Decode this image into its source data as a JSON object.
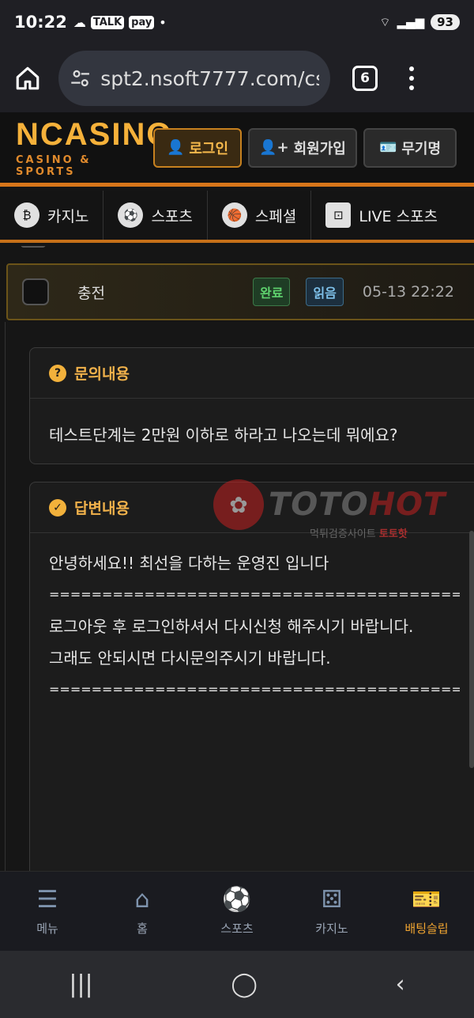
{
  "status": {
    "time": "10:22",
    "icons": [
      "cloud-icon",
      "talk-icon",
      "pay-icon"
    ],
    "talk": "TALK",
    "pay": "pay",
    "battery": "93"
  },
  "browser": {
    "url": "spt2.nsoft7777.com/cs",
    "tab_count": "6"
  },
  "header": {
    "logo_main": "NCASINO",
    "logo_sub": "CASINO & SPORTS",
    "login": "로그인",
    "signup": "회원가입",
    "anon": "무기명"
  },
  "nav": [
    {
      "label": "카지노",
      "icon": "casino-chip-icon"
    },
    {
      "label": "스포츠",
      "icon": "soccer-ball-icon"
    },
    {
      "label": "스페셜",
      "icon": "basketball-icon"
    },
    {
      "label": "LIVE 스포츠",
      "icon": "live-field-icon"
    }
  ],
  "notice": {
    "title": "충전",
    "status": "완료",
    "read": "읽음",
    "date": "05-13 22:22"
  },
  "inquiry": {
    "heading": "문의내용",
    "text": "테스트단계는 2만원 이하로 하라고 나오는데 뭐에요?"
  },
  "answer": {
    "heading": "답변내용",
    "lines": [
      "안녕하세요!! 최선을 다하는 운영진 입니다",
      "",
      "================================================",
      "",
      "로그아웃 후 로그인하셔서 다시신청 해주시기 바랍니다.",
      "그래도 안되시면 다시문의주시기 바랍니다.",
      "",
      "",
      "================================================"
    ]
  },
  "watermark": {
    "brand_a": "TOTO",
    "brand_b": "HOT",
    "sub_a": "먹튀검증사이트 ",
    "sub_b": "토토핫"
  },
  "bottom_nav": [
    {
      "label": "메뉴",
      "icon": "hamburger-icon"
    },
    {
      "label": "홈",
      "icon": "home-icon"
    },
    {
      "label": "스포츠",
      "icon": "soccer-ball-icon"
    },
    {
      "label": "카지노",
      "icon": "dice-icon"
    },
    {
      "label": "배팅슬립",
      "icon": "ticket-icon"
    }
  ],
  "colors": {
    "accent": "#f1a531",
    "border_orange": "#d8761a",
    "done_green": "#5fd36e"
  }
}
